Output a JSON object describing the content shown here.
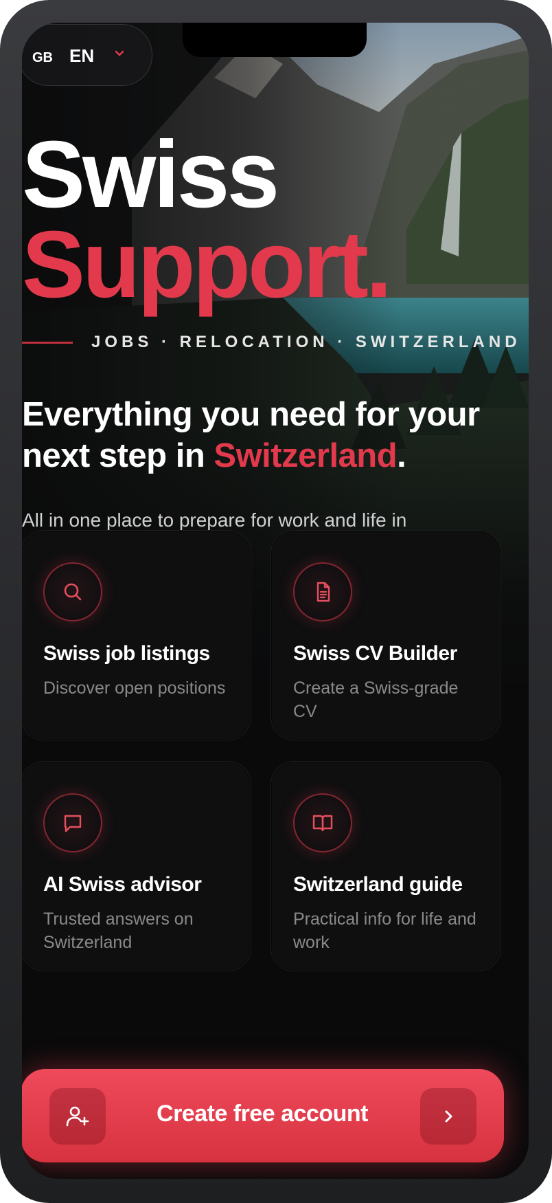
{
  "language": {
    "flag": "GB",
    "code": "EN"
  },
  "hero": {
    "title_line1": "Swiss",
    "title_line2": "Support.",
    "tagline": "JOBS · RELOCATION · SWITZERLAND"
  },
  "intro": {
    "headline_part1": "Everything you need for your next step in ",
    "headline_accent": "Switzerland",
    "headline_end": ".",
    "subtitle": "All in one place to prepare for work and life in Switzerland."
  },
  "features": [
    {
      "title": "Swiss job listings",
      "desc": "Discover open positions",
      "icon": "search-icon"
    },
    {
      "title": "Swiss CV Builder",
      "desc": "Create a Swiss-grade CV",
      "icon": "document-icon"
    },
    {
      "title": "AI Swiss advisor",
      "desc": "Trusted answers on Switzerland",
      "icon": "chat-icon"
    },
    {
      "title": "Switzerland guide",
      "desc": "Practical info for life and work",
      "icon": "book-icon"
    }
  ],
  "cta": {
    "label": "Create free account",
    "left_icon": "add-user-icon",
    "right_icon": "chevron-right-icon"
  },
  "colors": {
    "accent": "#e23a4c",
    "background": "#0a0a0b",
    "card": "#0f0f10"
  }
}
